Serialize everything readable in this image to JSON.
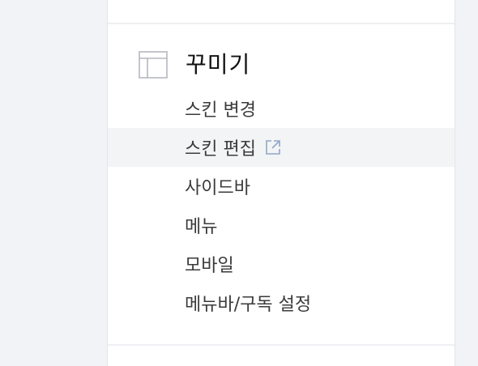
{
  "section": {
    "title": "꾸미기",
    "icon": "layout-icon"
  },
  "menu": {
    "items": [
      {
        "label": "스킨 변경"
      },
      {
        "label": "스킨 편집",
        "external": true,
        "icon": "external-link-icon"
      },
      {
        "label": "사이드바"
      },
      {
        "label": "메뉴"
      },
      {
        "label": "모바일"
      },
      {
        "label": "메뉴바/구독 설정"
      }
    ]
  },
  "colors": {
    "page_bg": "#f2f3f6",
    "panel_bg": "#ffffff",
    "active_bg": "#f3f4f6",
    "icon_stroke": "#b5b8bf",
    "title_text": "#111111",
    "item_text": "#3b3b3b"
  }
}
